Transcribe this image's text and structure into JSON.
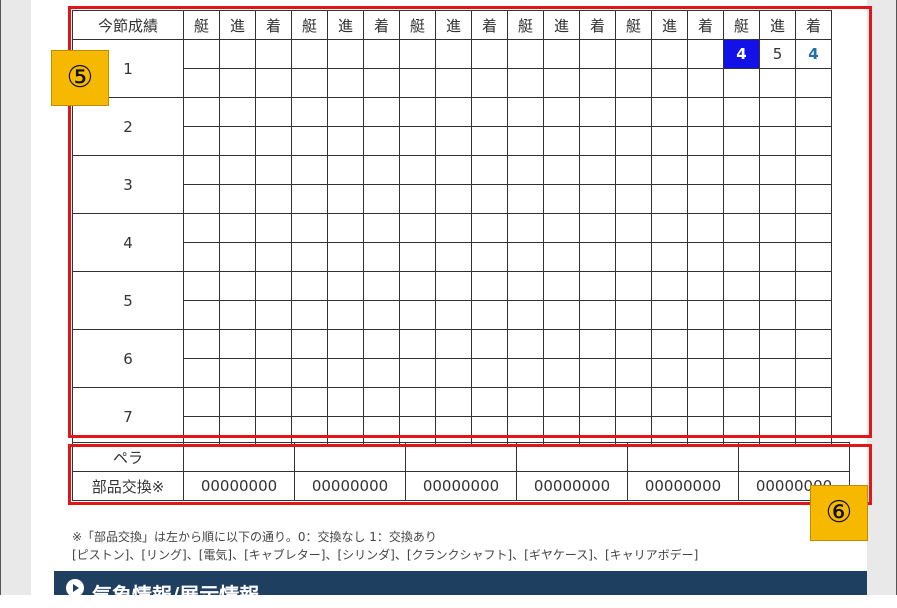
{
  "results_table": {
    "header_label": "今節成績",
    "column_groups": 6,
    "sub_headers": [
      "艇",
      "進",
      "着"
    ],
    "rows": [
      "1",
      "2",
      "3",
      "4",
      "5",
      "6",
      "7"
    ],
    "filled": {
      "row": "1",
      "group": 5,
      "boat": "4",
      "course": "5",
      "finish": "4"
    }
  },
  "parts_table": {
    "propeller_label": "ペラ",
    "parts_label": "部品交換※",
    "parts_values": [
      "00000000",
      "00000000",
      "00000000",
      "00000000",
      "00000000",
      "00000000"
    ]
  },
  "callouts": {
    "badge_5": "⑤",
    "badge_6": "⑥",
    "highlight_color": "#e0161a",
    "badge_color": "#f7b800"
  },
  "notes": {
    "line1": "※「部品交換」は左から順に以下の通り。0：交換なし 1：交換あり",
    "line2": "[ピストン]、[リング]、[電気]、[キャブレター]、[シリンダ]、[クランクシャフト]、[ギヤケース]、[キャリアボデー]"
  },
  "section_bar": {
    "title": "気象情報/展示情報"
  },
  "accent_colors": {
    "selected_boat_bg": "#1212e8",
    "finish_text": "#1f6fa8",
    "section_bar_bg": "#1f3f60"
  }
}
